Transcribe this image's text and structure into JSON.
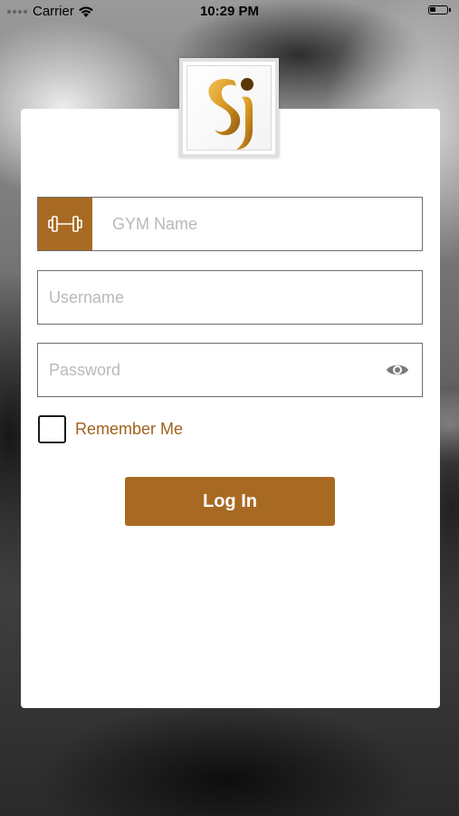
{
  "status_bar": {
    "carrier": "Carrier",
    "time": "10:29 PM",
    "wifi_icon": "wifi-icon",
    "battery_icon": "battery-icon"
  },
  "logo": {
    "icon": "app-logo-icon",
    "brand_color": "#a86a22"
  },
  "form": {
    "gym_name": {
      "placeholder": "GYM Name",
      "value": "",
      "icon": "dumbbell-icon"
    },
    "username": {
      "placeholder": "Username",
      "value": ""
    },
    "password": {
      "placeholder": "Password",
      "value": "",
      "toggle_icon": "eye-icon"
    },
    "remember_me": {
      "label": "Remember Me",
      "checked": false
    },
    "login_label": "Log In"
  },
  "colors": {
    "accent": "#a86a22",
    "label_accent": "#a0621c",
    "card_background": "#ffffff",
    "field_border": "#6d6d6d"
  }
}
